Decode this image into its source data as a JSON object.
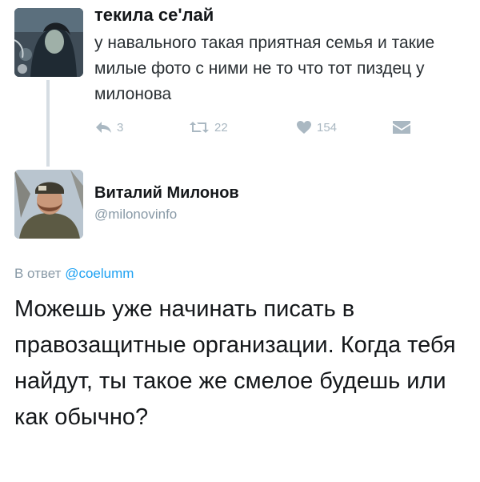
{
  "tweet1": {
    "author_name": "текила се'лай",
    "text": "у навального такая приятная семья и такие милые фото с ними не то что тот пиздец у милонова",
    "actions": {
      "reply_count": "3",
      "retweet_count": "22",
      "like_count": "154"
    }
  },
  "tweet2": {
    "author_name": "Виталий Милонов",
    "author_handle": "@milonovinfo",
    "reply_prefix": "В ответ",
    "reply_mention": "@coelumm",
    "text": "Можешь уже начинать писать в правозащитные организации. Когда тебя найдут, ты такое же смелое будешь или как обычно?"
  },
  "colors": {
    "accent": "#1da1f2",
    "muted": "#8899a6",
    "icon": "#aab8c2"
  }
}
